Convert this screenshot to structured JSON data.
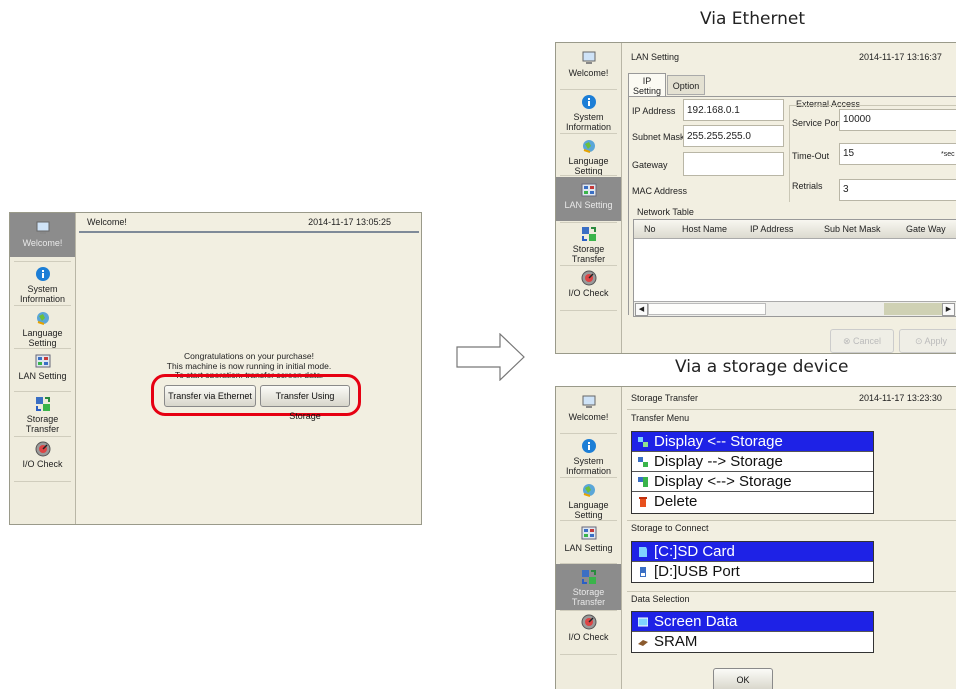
{
  "labels": {
    "via_ethernet": "Via Ethernet",
    "via_storage": "Via a storage device"
  },
  "sidebar": {
    "items": [
      {
        "label": "Welcome!",
        "icon": "monitor-icon"
      },
      {
        "label": "System Information",
        "icon": "info-icon"
      },
      {
        "label": "Language Setting",
        "icon": "globe-icon"
      },
      {
        "label": "LAN Setting",
        "icon": "network-icon"
      },
      {
        "label": "Storage Transfer",
        "icon": "storage-transfer-icon"
      },
      {
        "label": "I/O Check",
        "icon": "gauge-icon"
      }
    ]
  },
  "welcome_screen": {
    "title": "Welcome!",
    "datetime": "2014-11-17  13:05:25",
    "message": [
      "Congratulations on your purchase!",
      "This machine is now running in initial mode.",
      "To start operation, transfer screen data."
    ],
    "buttons": {
      "ethernet": "Transfer via Ethernet",
      "storage": "Transfer Using Storage"
    },
    "highlight_color": "#e60012"
  },
  "lan_screen": {
    "title": "LAN Setting",
    "datetime": "2014-11-17  13:16:37",
    "tabs": [
      "IP Setting",
      "Option"
    ],
    "ip_address": {
      "label": "IP Address",
      "value": "192.168.0.1"
    },
    "subnet_mask": {
      "label": "Subnet Mask",
      "value": "255.255.255.0"
    },
    "gateway": {
      "label": "Gateway",
      "value": ""
    },
    "mac_address": {
      "label": "MAC Address",
      "value": ""
    },
    "external_access": {
      "label": "External Access",
      "service_port": {
        "label": "Service Port",
        "value": "10000"
      },
      "timeout": {
        "label": "Time-Out",
        "value": "15",
        "unit": "*sec"
      },
      "retrials": {
        "label": "Retrials",
        "value": "3"
      }
    },
    "network_table": {
      "label": "Network Table",
      "columns": [
        "No",
        "Host Name",
        "IP Address",
        "Sub Net Mask",
        "Gate Way"
      ],
      "rows": []
    },
    "buttons": {
      "cancel": "Cancel",
      "apply": "Apply"
    }
  },
  "storage_screen": {
    "title": "Storage Transfer",
    "datetime": "2014-11-17  13:23:30",
    "transfer_menu": {
      "label": "Transfer Menu",
      "items": [
        {
          "label": "Display <-- Storage",
          "selected": true
        },
        {
          "label": "Display --> Storage",
          "selected": false
        },
        {
          "label": "Display <--> Storage",
          "selected": false
        },
        {
          "label": "Delete",
          "selected": false
        }
      ]
    },
    "storage_to_connect": {
      "label": "Storage to Connect",
      "items": [
        {
          "label": "[C:]SD Card",
          "selected": true
        },
        {
          "label": "[D:]USB Port",
          "selected": false
        }
      ]
    },
    "data_selection": {
      "label": "Data Selection",
      "items": [
        {
          "label": "Screen Data",
          "selected": true
        },
        {
          "label": "SRAM",
          "selected": false
        }
      ]
    },
    "ok_button": "OK"
  }
}
